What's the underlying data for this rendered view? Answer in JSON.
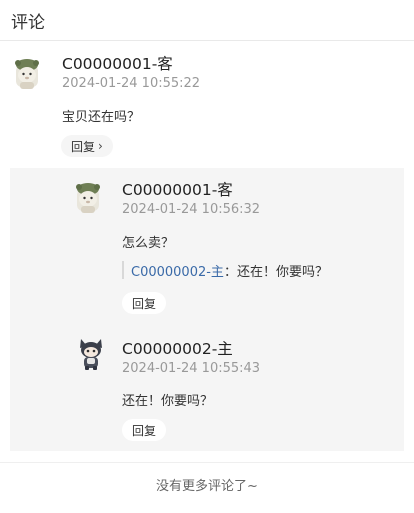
{
  "header": {
    "title": "评论"
  },
  "comment": {
    "author": "C00000001-客",
    "time": "2024-01-24 10:55:22",
    "text": "宝贝还在吗？",
    "reply_label": "回复",
    "avatar_icon": "bear-avatar-icon"
  },
  "replies": [
    {
      "author": "C00000001-客",
      "time": "2024-01-24 10:56:32",
      "text": "怎么卖？",
      "quote_user": "C00000002-主",
      "quote_sep": "：",
      "quote_text": "还在！你要吗？",
      "reply_label": "回复",
      "avatar_icon": "bear-avatar-icon"
    },
    {
      "author": "C00000002-主",
      "time": "2024-01-24 10:55:43",
      "text": "还在！你要吗？",
      "reply_label": "回复",
      "avatar_icon": "cat-avatar-icon"
    }
  ],
  "footer": {
    "text": "没有更多评论了~"
  },
  "colors": {
    "link": "#3a6aa8",
    "reply_bg": "#f5f5f5",
    "muted": "#999999"
  }
}
